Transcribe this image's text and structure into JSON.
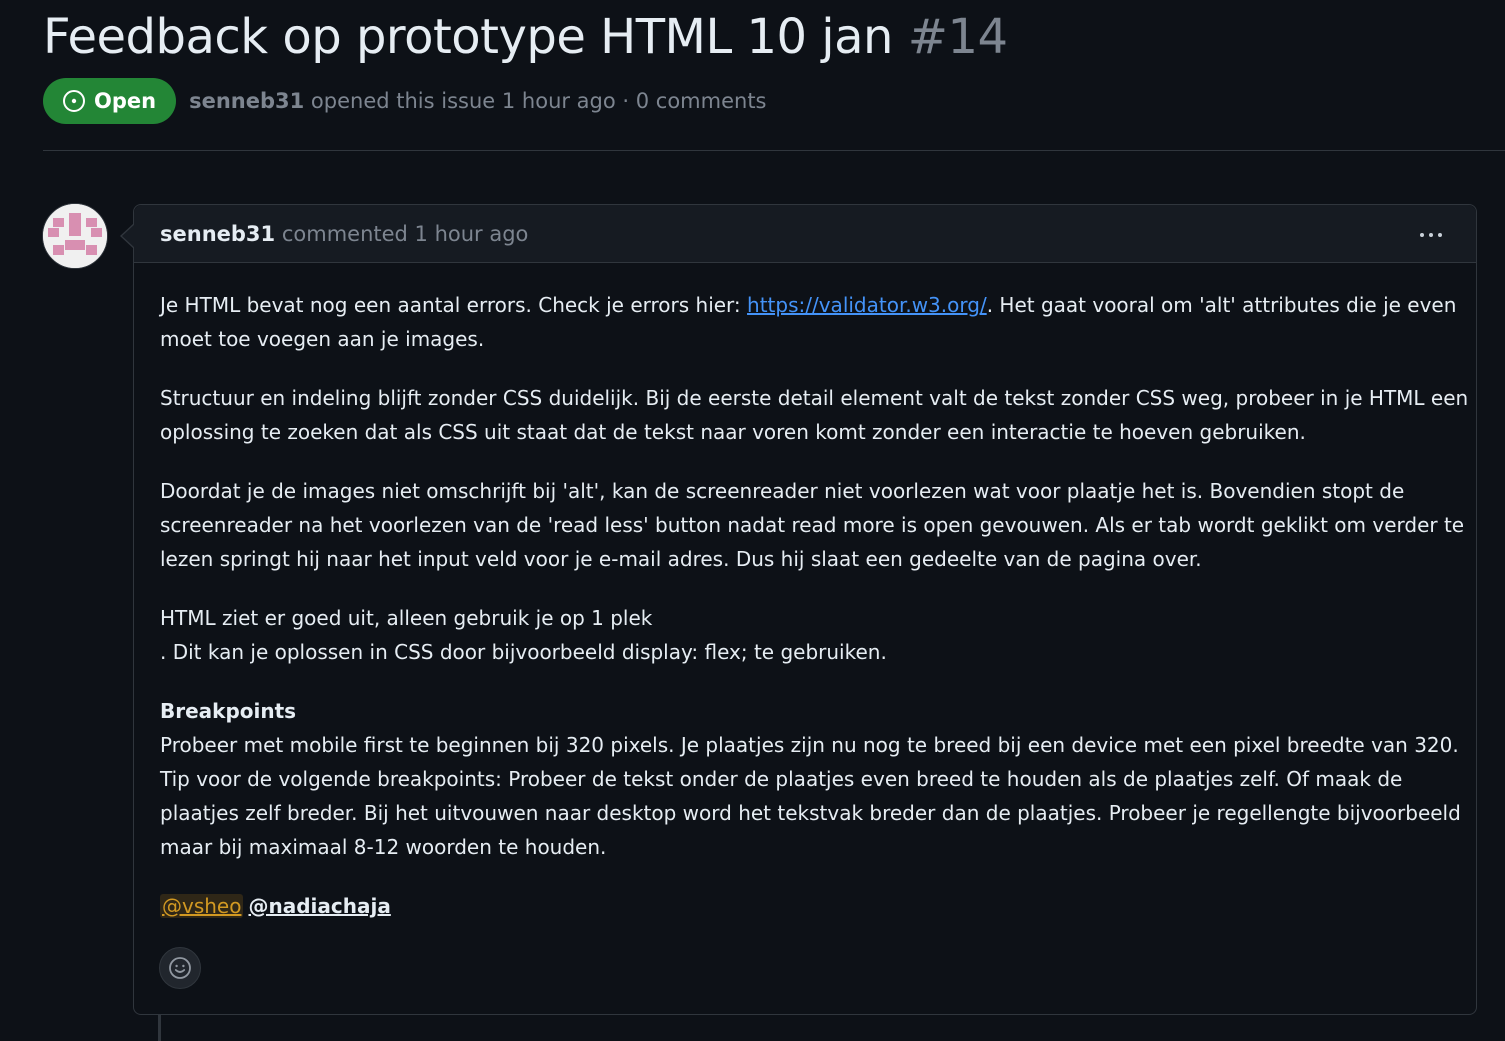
{
  "issue": {
    "title": "Feedback op prototype HTML 10 jan",
    "number": "#14",
    "state": "Open",
    "author": "senneb31",
    "opened_text": "opened this issue 1 hour ago · 0 comments"
  },
  "comment": {
    "author": "senneb31",
    "action": "commented 1 hour ago",
    "paragraphs": {
      "p1": {
        "before_link": "Je HTML bevat nog een aantal errors. Check je errors hier: ",
        "link_text": "https://validator.w3.org/",
        "after_link": ". Het gaat vooral om 'alt' attributes die je even",
        "line2": "moet toe voegen aan je images."
      },
      "p2": {
        "line1": "Structuur en indeling blijft zonder CSS duidelijk. Bij de eerste detail element valt de tekst zonder CSS weg, probeer in je HTML een",
        "line2": "oplossing te zoeken dat als CSS uit staat dat de tekst naar voren komt zonder een interactie te hoeven gebruiken."
      },
      "p3": {
        "line1": "Doordat je de images niet omschrijft bij 'alt', kan de screenreader niet voorlezen wat voor plaatje het is. Bovendien stopt de",
        "line2": "screenreader na het voorlezen van de 'read less' button nadat read more is open gevouwen. Als er tab wordt geklikt om verder te",
        "line3": "lezen springt hij naar het input veld voor je e-mail adres. Dus hij slaat een gedeelte van de pagina over."
      },
      "p4": {
        "line1": "HTML ziet er goed uit, alleen gebruik je op 1 plek",
        "line2": ". Dit kan je oplossen in CSS door bijvoorbeeld display: flex; te gebruiken."
      },
      "p5": {
        "heading": "Breakpoints",
        "line1": "Probeer met mobile first te beginnen bij 320 pixels. Je plaatjes zijn nu nog te breed bij een device met een pixel breedte van 320.",
        "line2": "Tip voor de volgende breakpoints: Probeer de tekst onder de plaatjes even breed te houden als de plaatjes zelf. Of maak de",
        "line3": "plaatjes zelf breder. Bij het uitvouwen naar desktop word het tekstvak breder dan de plaatjes. Probeer je regellengte bijvoorbeeld",
        "line4": "maar bij maximaal 8-12 woorden te houden."
      }
    },
    "mentions": [
      "@vsheo",
      "@nadiachaja"
    ]
  },
  "icons": {
    "state": "issue-opened-icon",
    "menu": "kebab-horizontal-icon",
    "reaction": "smiley-icon"
  },
  "colors": {
    "background": "#0d1117",
    "header_bg": "#161b22",
    "border": "#30363d",
    "open_badge": "#238636",
    "link": "#4493f8",
    "mention_highlight": "#d29922",
    "muted_text": "#7d8590"
  }
}
